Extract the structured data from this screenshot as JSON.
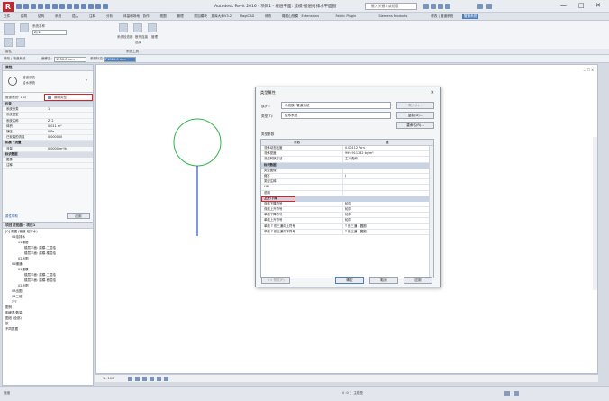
{
  "window": {
    "app_letter": "R",
    "title": "Autodesk Revit 2016 -    项目1 - 楼层平面: 建模-楼层给排水平面图",
    "search_placeholder": "键入关键字或短语",
    "minimize": "—",
    "maximize": "□",
    "close": "✕"
  },
  "menu": {
    "items": [
      "文件",
      "建筑",
      "结构",
      "系统",
      "插入",
      "注释",
      "分析",
      "体量和场地",
      "协作",
      "视图",
      "管理",
      "附加模块",
      "族库大师V3.2",
      "MagiCAD",
      "修改",
      "橄榄山快模",
      "Extensions",
      "Fabric Plugin",
      "Siemens Products",
      "修改 | 管道系统",
      "管道系统"
    ],
    "active_index": 20
  },
  "ribbon": {
    "group1_label": "属性",
    "group2_label": "系统工具",
    "buttons": [
      "编辑系统",
      "选择",
      "修改",
      "编辑类型",
      "添加到系统",
      "从系统中删除",
      "选择设备"
    ],
    "system_name": "系统名称",
    "system_value": "ZJ 2",
    "tool_labels": [
      "系统检查器",
      "断开连接",
      "管理",
      "选择"
    ]
  },
  "optionbar": {
    "label1": "修改 | 管道系统",
    "height_label": "偏移量:",
    "height_value": "1250.0 mm",
    "label2": "参照标高:",
    "level_value": "F1000.0 mm"
  },
  "properties": {
    "header": "属性",
    "type_title": "管道系统",
    "type_subtitle": "给水系统",
    "selector_label": "管道系统: 1 ZJ",
    "edit_type": "编辑类型",
    "sections": [
      {
        "name": "约束",
        "rows": [
          {
            "k": "系统分类",
            "v": "1"
          },
          {
            "k": "系统类型",
            "v": ""
          },
          {
            "k": "系统名称",
            "v": "ZJ 2"
          },
          {
            "k": "体积",
            "v": "0.011 m³"
          },
          {
            "k": "静压",
            "v": "0 Pa"
          },
          {
            "k": "已安装的流量",
            "v": "0.000000"
          }
        ]
      },
      {
        "name": "机械 - 流量",
        "rows": [
          {
            "k": "流量",
            "v": "0.0000 m³/h"
          }
        ]
      },
      {
        "name": "标识数据",
        "rows": [
          {
            "k": "图像",
            "v": ""
          },
          {
            "k": "注释",
            "v": ""
          }
        ]
      }
    ],
    "help_link": "属性帮助",
    "apply": "应用"
  },
  "browser": {
    "header": "项目浏览器 - 项目1",
    "items": [
      {
        "indent": 0,
        "text": "[0] 视图 (管道-给排水)"
      },
      {
        "indent": 1,
        "text": "01给排水"
      },
      {
        "indent": 2,
        "text": "01楼层"
      },
      {
        "indent": 3,
        "text": "楼层平面: 建模-二层给"
      },
      {
        "indent": 3,
        "text": "楼层平面: 建模-楼层给"
      },
      {
        "indent": 2,
        "text": "02出图"
      },
      {
        "indent": 1,
        "text": "02暖通"
      },
      {
        "indent": 2,
        "text": "01建模"
      },
      {
        "indent": 3,
        "text": "楼层平面: 建模-二层给"
      },
      {
        "indent": 3,
        "text": "楼层平面: 建模-首层给"
      },
      {
        "indent": 2,
        "text": "02出图"
      },
      {
        "indent": 1,
        "text": "03出图"
      },
      {
        "indent": 1,
        "text": "04三维"
      },
      {
        "indent": 1,
        "text": "???"
      },
      {
        "indent": 0,
        "text": "图例"
      },
      {
        "indent": 0,
        "text": "明细表/数量"
      },
      {
        "indent": 0,
        "text": "图纸 (全部)"
      },
      {
        "indent": 0,
        "text": "族"
      },
      {
        "indent": 0,
        "text": "不同数据"
      }
    ]
  },
  "canvas": {
    "corner_controls": "— ☐ ✕"
  },
  "viewbar": {
    "scale": "1 : 100"
  },
  "statusbar": {
    "text": "就绪",
    "right_text": "0  :0  ⋮  主模型"
  },
  "dialog": {
    "title": "类型属性",
    "close": "✕",
    "family_label": "族(F):",
    "family_value": "系统族: 管道系统",
    "load_button": "载入(L)...",
    "type_label": "类型(T):",
    "type_value": "给水系统",
    "duplicate_button": "复制(D)...",
    "rename_button": "重命名(R)...",
    "type_params_label": "类型参数",
    "col_param": "参数",
    "col_value": "值",
    "sections": [
      {
        "name": "",
        "rows": [
          {
            "k": "流体动态粘度",
            "v": "0.00112 Pa·s"
          },
          {
            "k": "流体密度",
            "v": "999.911782 kg/m³"
          },
          {
            "k": "流量转换方法",
            "v": "主冲洗阀"
          }
        ]
      },
      {
        "name": "标识数据",
        "rows": [
          {
            "k": "类型图像",
            "v": ""
          },
          {
            "k": "缩写",
            "v": "J"
          },
          {
            "k": "类型注释",
            "v": ""
          },
          {
            "k": "URL",
            "v": ""
          },
          {
            "k": "说明",
            "v": ""
          }
        ]
      },
      {
        "name": "上升/下降",
        "rows": [
          {
            "k": "双线下降符号",
            "v": "轮廓"
          },
          {
            "k": "双线上升符号",
            "v": "轮廓"
          },
          {
            "k": "单线下降符号",
            "v": "轮廓"
          },
          {
            "k": "单线上升符号",
            "v": "轮廓"
          },
          {
            "k": "单线 T 形三通向上符号",
            "v": "T 形三通 - 圆圈"
          },
          {
            "k": "单线 T 形三通向下符号",
            "v": "T 形三通 - 圆圈"
          }
        ]
      }
    ],
    "preview_button": "<< 预览(P)",
    "ok_button": "确定",
    "cancel_button": "取消",
    "apply_button": "应用"
  },
  "colors": {
    "accent": "#4d7fbf",
    "highlight": "#e02020",
    "pipe_circle": "#2db34a",
    "pipe_line": "#2a4fd6"
  }
}
